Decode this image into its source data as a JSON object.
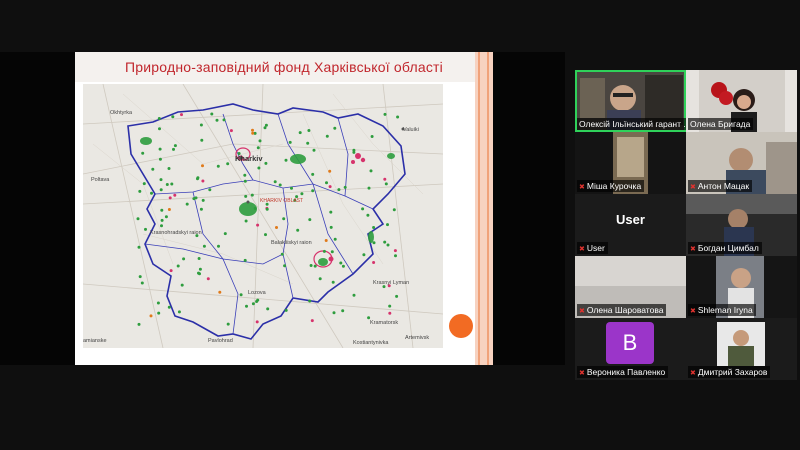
{
  "slide": {
    "title": "Природно-заповідний фонд Харківської області"
  },
  "map": {
    "labels": [
      "Okhtyrka",
      "Kharkiv",
      "Valuiki",
      "Poltava",
      "Krasnohradskyi raion",
      "KHARKIV OBLAST",
      "Balakliiskyi raion",
      "Lozova",
      "Krasnyi Lyman",
      "Kramatorsk",
      "Pavlohrad",
      "Kostiantynivka",
      "Artemivsk",
      "amianske"
    ],
    "colors": {
      "boundary": "#2b2fa8",
      "reserve_green": "#2e9d3e",
      "reserve_pink": "#d6336c",
      "reserve_orange": "#e07a1a",
      "land": "#eae8e3"
    }
  },
  "participants": [
    {
      "name": "Олексій Ільїнський гарант ...",
      "muted": false,
      "active": true
    },
    {
      "name": "Олена Бригада",
      "muted": false,
      "active": false
    },
    {
      "name": "Міша Курочка",
      "muted": true,
      "active": false
    },
    {
      "name": "Антон Мацак",
      "muted": true,
      "active": false
    },
    {
      "name": "User",
      "muted": true,
      "active": false,
      "placeholder": "User"
    },
    {
      "name": "Богдан Цимбал",
      "muted": true,
      "active": false
    },
    {
      "name": "Олена Шароватова",
      "muted": true,
      "active": false
    },
    {
      "name": "Shleman Iryna",
      "muted": true,
      "active": false
    },
    {
      "name": "Вероника Павленко",
      "muted": true,
      "active": false,
      "avatar_letter": "В"
    },
    {
      "name": "Дмитрий Захаров",
      "muted": true,
      "active": false
    }
  ],
  "icons": {
    "mic_muted": "mic-muted-icon"
  }
}
